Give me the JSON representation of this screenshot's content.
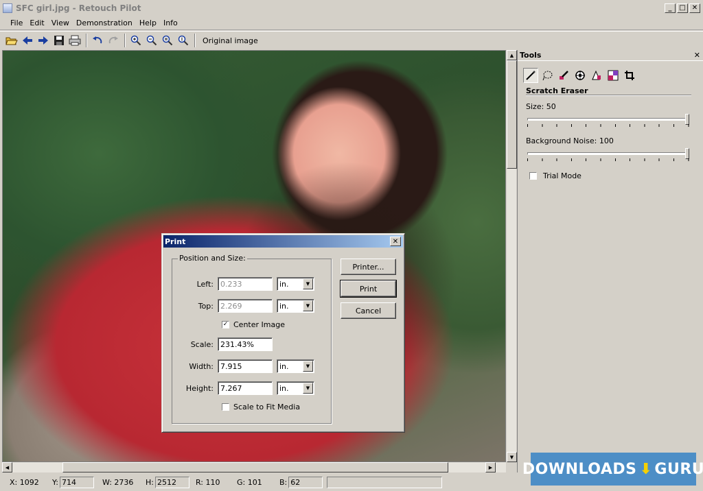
{
  "window": {
    "title": "SFC girl.jpg - Retouch Pilot"
  },
  "menu": [
    "File",
    "Edit",
    "View",
    "Demonstration",
    "Help",
    "Info"
  ],
  "toolbar": {
    "icons": [
      "open-icon",
      "back-icon",
      "forward-icon",
      "save-icon",
      "print-icon",
      "undo-icon",
      "redo-icon",
      "zoom-in-icon",
      "zoom-out-icon",
      "zoom-fit-icon",
      "zoom-actual-icon"
    ],
    "original_image_label": "Original image"
  },
  "tools_panel": {
    "title": "Tools",
    "tools": [
      "scratch-eraser-icon",
      "lasso-icon",
      "brush-icon",
      "stamp-icon",
      "color-icon",
      "replace-icon",
      "crop-icon"
    ],
    "tool_name": "Scratch Eraser",
    "size_label": "Size: 50",
    "size_value_fraction": 1.0,
    "noise_label": "Background Noise: 100",
    "noise_value_fraction": 1.0,
    "trial_mode_label": "Trial Mode",
    "trial_mode_checked": false
  },
  "print_dialog": {
    "title": "Print",
    "group_label": "Position and Size:",
    "left_label": "Left:",
    "left_value": "0.233",
    "left_unit": "in.",
    "top_label": "Top:",
    "top_value": "2.269",
    "top_unit": "in.",
    "center_image_label": "Center Image",
    "center_image_checked": true,
    "scale_label": "Scale:",
    "scale_value": "231.43%",
    "width_label": "Width:",
    "width_value": "7.915",
    "width_unit": "in.",
    "height_label": "Height:",
    "height_value": "7.267",
    "height_unit": "in.",
    "scale_to_fit_label": "Scale to Fit Media",
    "scale_to_fit_checked": false,
    "printer_button": "Printer...",
    "print_button": "Print",
    "cancel_button": "Cancel"
  },
  "status": {
    "x_label": "X: 1092",
    "y_label": "Y:",
    "y_value": "714",
    "w_label": "W: 2736",
    "h_label": "H:",
    "h_value": "2512",
    "r_label": "R: 110",
    "g_label": "G: 101",
    "b_label": "B:",
    "b_value": "62"
  },
  "watermark": {
    "left": "DOWNLOADS",
    "right": "GURU"
  }
}
